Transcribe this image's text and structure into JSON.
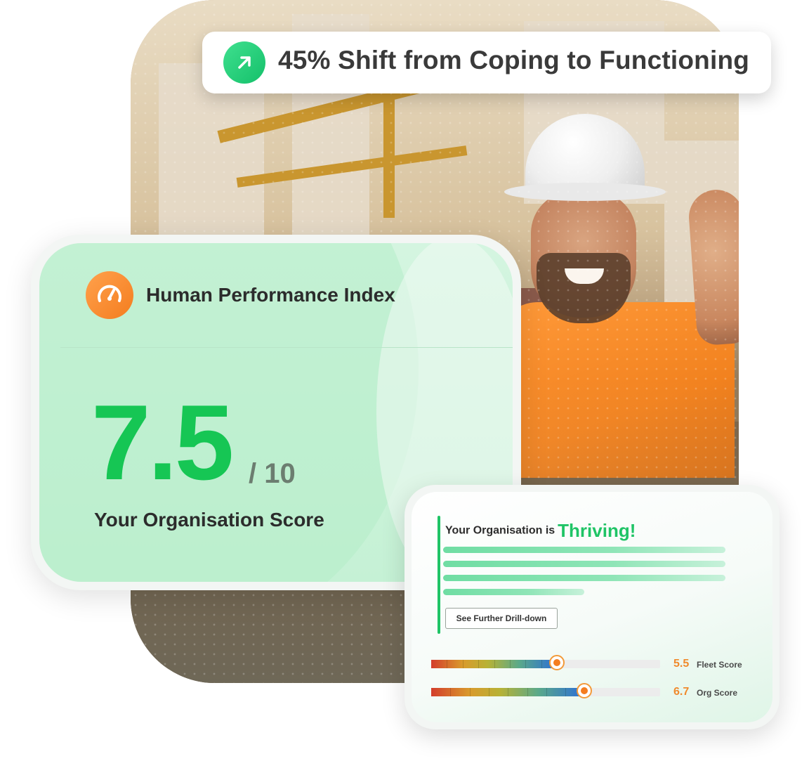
{
  "shift_badge": {
    "icon": "arrow-up-right-icon",
    "text": "45% Shift from Coping to Functioning",
    "icon_color": "#1fc466"
  },
  "hpi_card": {
    "icon": "speedometer-icon",
    "title": "Human Performance Index",
    "score": "7.5",
    "out_of": "/ 10",
    "subtitle": "Your Organisation Score",
    "score_color": "#16c654",
    "icon_color": "#f47d1f"
  },
  "thrive_card": {
    "heading_prefix": "Your Organisation is",
    "heading_status": "Thriving!",
    "status_color": "#1fc466",
    "button_label": "See Further Drill-down",
    "scores": [
      {
        "value": "5.5",
        "label": "Fleet Score",
        "level": 0.55
      },
      {
        "value": "6.7",
        "label": "Org Score",
        "level": 0.67
      }
    ],
    "accent_color": "#f08a2d"
  },
  "background_photo": {
    "subject": "construction-worker-thumbs-up"
  }
}
